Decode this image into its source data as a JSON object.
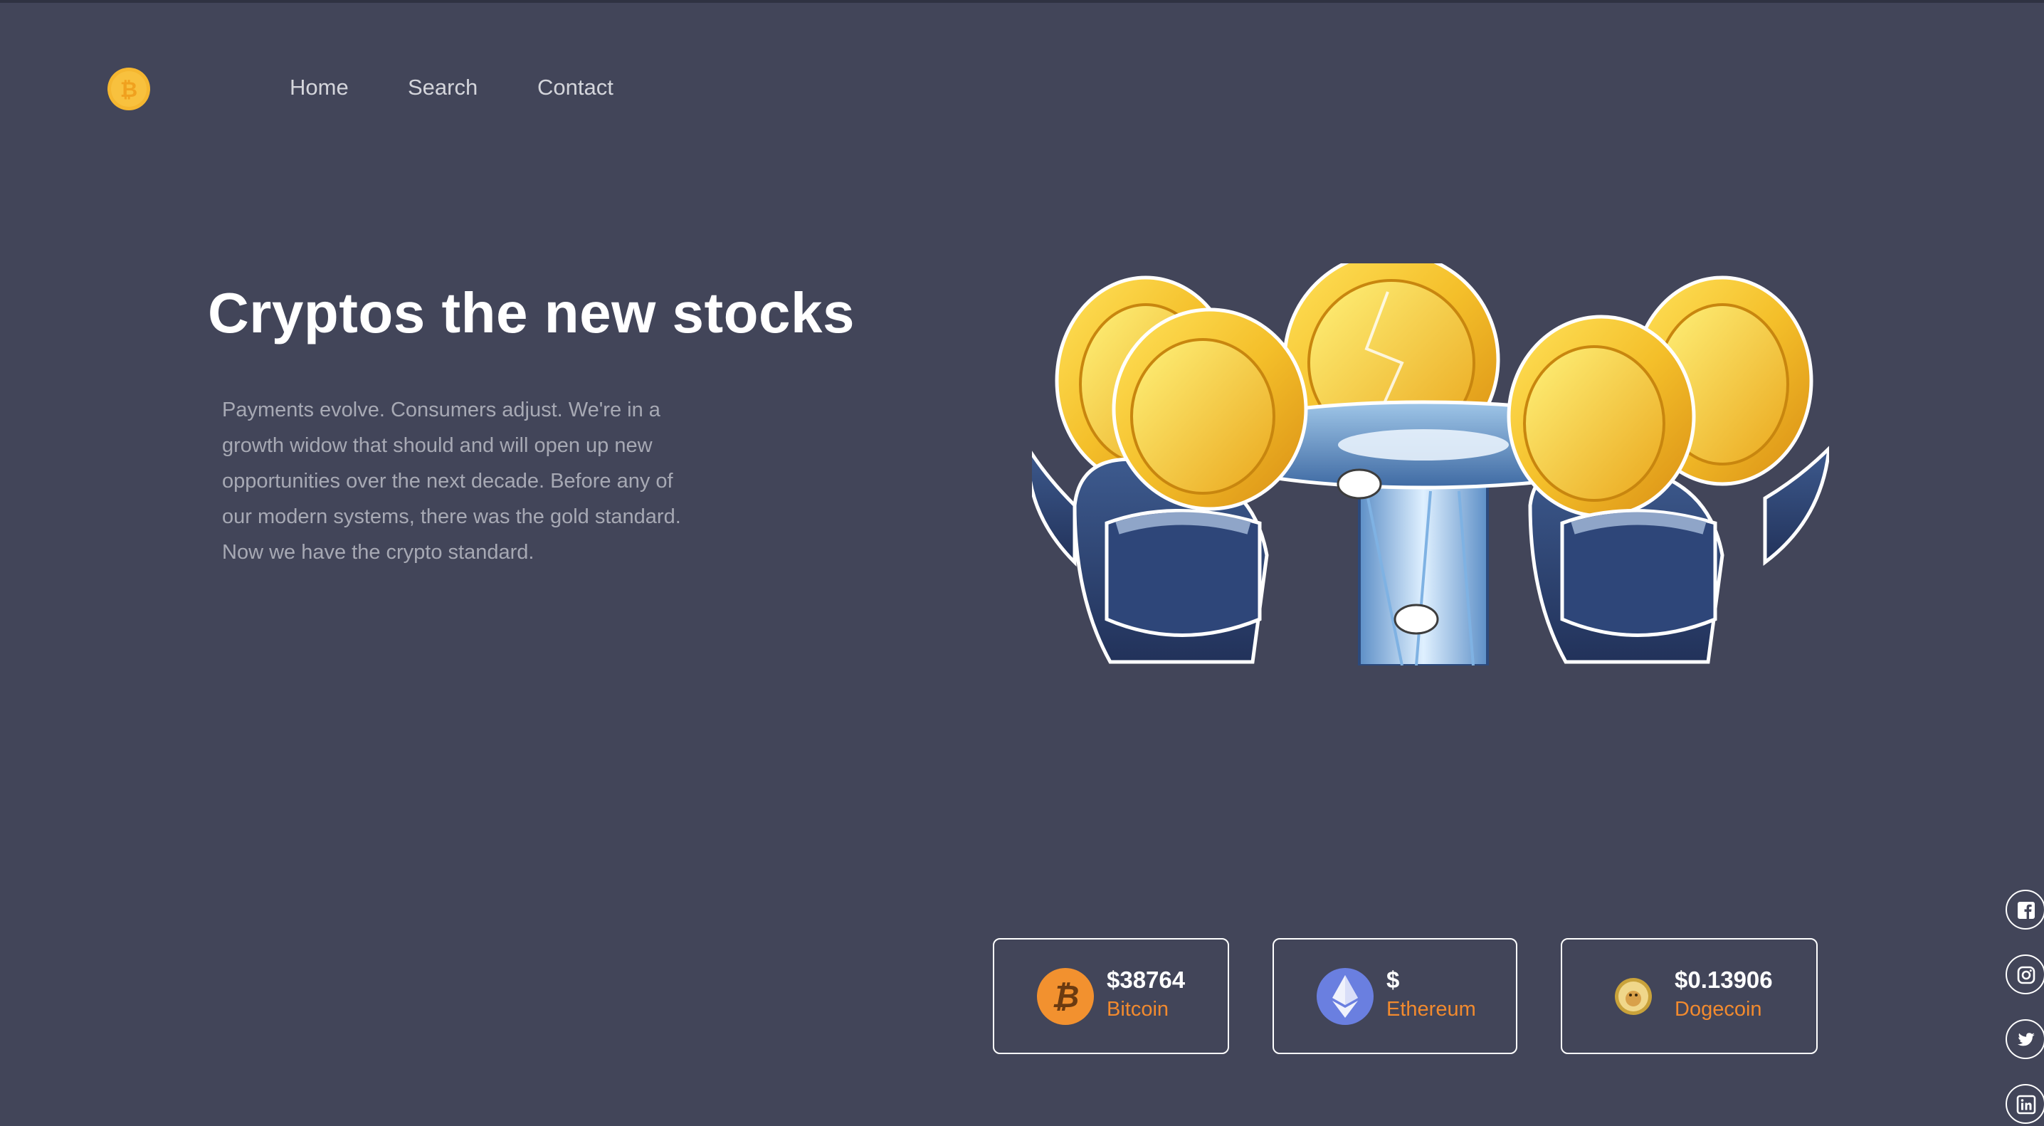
{
  "nav": {
    "home": "Home",
    "search": "Search",
    "contact": "Contact"
  },
  "hero": {
    "title": "Cryptos the new stocks",
    "text": "Payments evolve. Consumers adjust. We're in a growth widow that should and will open up new opportunities over the next decade. Before any of our modern systems, there was the gold standard. Now we have the crypto standard."
  },
  "coins": [
    {
      "price": "$38764",
      "name": "Bitcoin",
      "icon": "bitcoin-icon"
    },
    {
      "price": "$",
      "name": "Ethereum",
      "icon": "ethereum-icon"
    },
    {
      "price": "$0.13906",
      "name": "Dogecoin",
      "icon": "dogecoin-icon"
    }
  ],
  "social": [
    "facebook-icon",
    "instagram-icon",
    "twitter-icon",
    "linkedin-icon"
  ],
  "colors": {
    "background": "#424559",
    "accent": "#f28a2e",
    "logo": "#f5b730",
    "ethereum": "#6a7fe0"
  }
}
